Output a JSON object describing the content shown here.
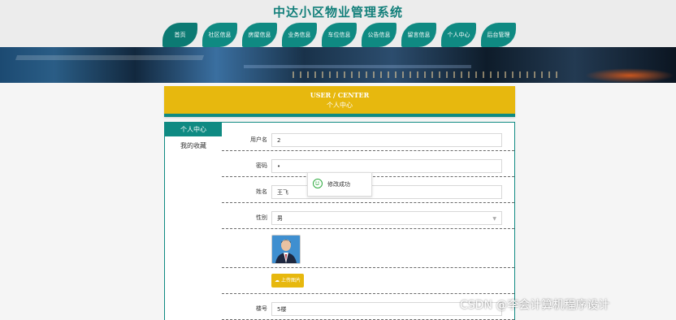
{
  "app": {
    "title": "中达小区物业管理系统"
  },
  "nav": {
    "items": [
      {
        "label": "首页"
      },
      {
        "label": "社区信息"
      },
      {
        "label": "房屋信息"
      },
      {
        "label": "业务信息"
      },
      {
        "label": "车位信息"
      },
      {
        "label": "公告信息"
      },
      {
        "label": "留言信息"
      },
      {
        "label": "个人中心"
      },
      {
        "label": "后台管理"
      }
    ]
  },
  "header": {
    "en_title": "USER / CENTER",
    "cn_title": "个人中心"
  },
  "sidebar": {
    "items": [
      {
        "label": "个人中心",
        "active": true
      },
      {
        "label": "我的收藏",
        "active": false
      }
    ]
  },
  "form": {
    "username": {
      "label": "用户名",
      "value": "2"
    },
    "password": {
      "label": "密码",
      "value": "•"
    },
    "name": {
      "label": "姓名",
      "value": "王飞"
    },
    "gender": {
      "label": "性别",
      "value": "男"
    },
    "upload_label": "上传图片",
    "building": {
      "label": "楼号",
      "value": "5楼"
    }
  },
  "toast": {
    "text": "修改成功"
  },
  "watermark": "CSDN @李会计算机程序设计",
  "colors": {
    "teal": "#0f8a82",
    "yellow": "#e7b80e",
    "title": "#127f7a",
    "success": "#2eaa3f"
  }
}
